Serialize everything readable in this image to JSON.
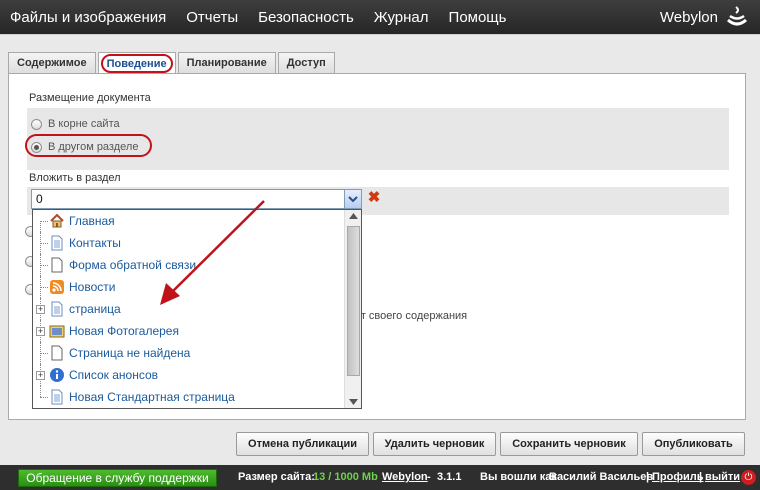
{
  "nav": {
    "items": [
      "Файлы и изображения",
      "Отчеты",
      "Безопасность",
      "Журнал",
      "Помощь"
    ],
    "brand": "Webylon"
  },
  "tabs": [
    "Содержимое",
    "Поведение",
    "Планирование",
    "Доступ"
  ],
  "placement": {
    "label": "Размещение документа",
    "option_root": "В корне сайта",
    "option_other": "В другом разделе"
  },
  "parent": {
    "label": "Вложить в раздел",
    "value": "0"
  },
  "tree": [
    {
      "label": "Главная",
      "icon": "home-icon"
    },
    {
      "label": "Контакты",
      "icon": "page-icon"
    },
    {
      "label": "Форма обратной связи",
      "icon": "blank-page-icon"
    },
    {
      "label": "Новости",
      "icon": "rss-icon"
    },
    {
      "label": "страница",
      "icon": "page-icon"
    },
    {
      "label": "Новая Фотогалерея",
      "icon": "gallery-icon"
    },
    {
      "label": "Страница не найдена",
      "icon": "blank-page-icon"
    },
    {
      "label": "Список анонсов",
      "icon": "info-icon"
    },
    {
      "label": "Новая Стандартная страница",
      "icon": "page-icon"
    }
  ],
  "behind_text": "нет своего содержания",
  "buttons": {
    "unpublish": "Отмена публикации",
    "delete_draft": "Удалить черновик",
    "save_draft": "Сохранить черновик",
    "publish": "Опубликовать"
  },
  "footer": {
    "support": "Обращение в службу поддержки",
    "size_label": "Размер сайта:",
    "size_value": "13 / 1000 Mb",
    "product": "Webylon",
    "version_sep": "-",
    "version": "3.1.1",
    "logged_as": "Вы вошли как",
    "user": "Василий Васильев",
    "sep": "|",
    "profile": "Профиль",
    "logout": "выйти"
  }
}
